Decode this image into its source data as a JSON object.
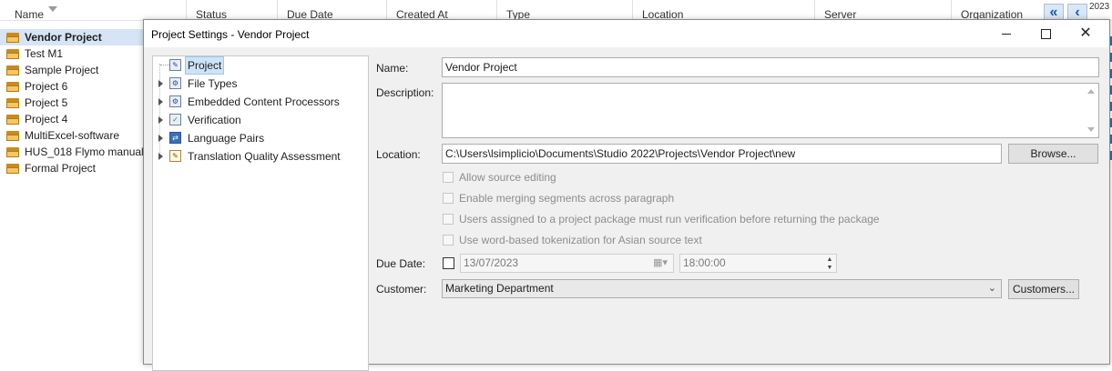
{
  "grid": {
    "columns": [
      "Name",
      "Status",
      "Due Date",
      "Created At",
      "Type",
      "Location",
      "Server",
      "Organization"
    ],
    "year_fragment": "2023",
    "nav_first": "«",
    "nav_prev": "‹",
    "projects": [
      {
        "name": "Vendor Project",
        "selected": true
      },
      {
        "name": "Test M1"
      },
      {
        "name": "Sample Project"
      },
      {
        "name": "Project 6"
      },
      {
        "name": "Project 5"
      },
      {
        "name": "Project 4"
      },
      {
        "name": "MultiExcel-software"
      },
      {
        "name": "HUS_018 Flymo manuals"
      },
      {
        "name": "Formal Project"
      }
    ]
  },
  "dialog": {
    "title": "Project Settings - Vendor Project",
    "minimize_icon": "minimize-icon",
    "maximize_icon": "maximize-icon",
    "close_label": "✕",
    "tree": [
      {
        "label": "Project",
        "icon": "project-icon",
        "selected": true
      },
      {
        "label": "File Types",
        "icon": "file-types-icon"
      },
      {
        "label": "Embedded Content Processors",
        "icon": "processor-icon"
      },
      {
        "label": "Verification",
        "icon": "verification-icon"
      },
      {
        "label": "Language Pairs",
        "icon": "language-pairs-icon"
      },
      {
        "label": "Translation Quality Assessment",
        "icon": "tqa-icon"
      }
    ],
    "form": {
      "name_label": "Name:",
      "name_value": "Vendor Project",
      "description_label": "Description:",
      "description_value": "",
      "location_label": "Location:",
      "location_value": "C:\\Users\\lsimplicio\\Documents\\Studio 2022\\Projects\\Vendor Project\\new",
      "browse_label": "Browse...",
      "options": [
        {
          "label": "Allow source editing",
          "checked": false
        },
        {
          "label": "Enable merging segments across paragraph",
          "checked": false
        },
        {
          "label": "Users assigned to a project package must run verification before returning the package",
          "checked": false
        },
        {
          "label": "Use word-based tokenization for Asian source text",
          "checked": false
        }
      ],
      "due_date_label": "Due Date:",
      "due_date_value": "13/07/2023",
      "due_time_value": "18:00:00",
      "customer_label": "Customer:",
      "customer_value": "Marketing Department",
      "customers_button": "Customers..."
    }
  }
}
